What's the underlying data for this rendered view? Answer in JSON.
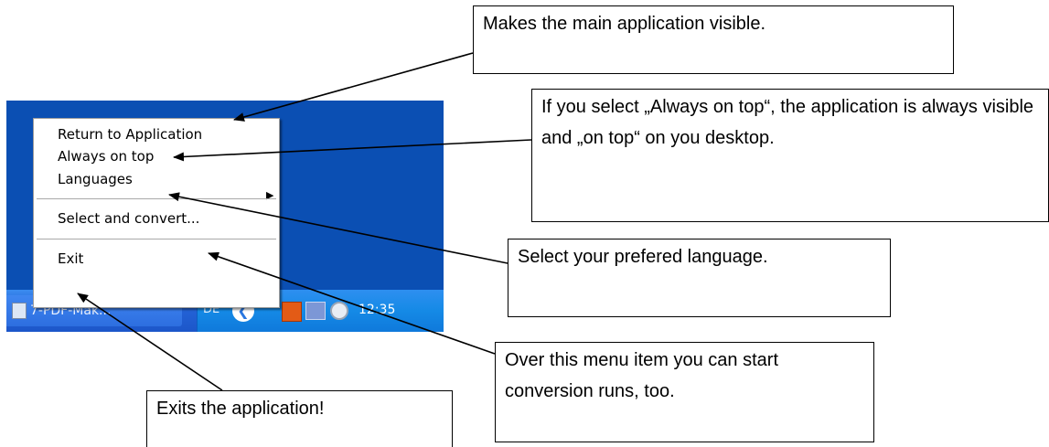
{
  "context_menu": {
    "items": [
      {
        "label": "Return to Application"
      },
      {
        "label": "Always on top"
      },
      {
        "label": "Languages",
        "submenu_arrow": "▶"
      },
      {
        "label": "Select and convert..."
      },
      {
        "label": "Exit"
      }
    ]
  },
  "taskbar": {
    "task_label": "7-PDF-Mak...",
    "language_indicator": "DE",
    "back_glyph": "❮",
    "clock": "12:35"
  },
  "callouts": {
    "return_to_application": "Makes the main application visible.",
    "always_on_top": "If you select „Always on top“, the application is always visible and „on top“ on you desktop.",
    "languages": "Select your prefered language.",
    "select_and_convert": "Over this menu item you can start conversion runs, too.",
    "exit": "Exits the application!"
  },
  "colors": {
    "desktop_blue": "#0b4fb3",
    "taskbar_blue": "#2464d8",
    "tray_blue": "#158ae6"
  }
}
